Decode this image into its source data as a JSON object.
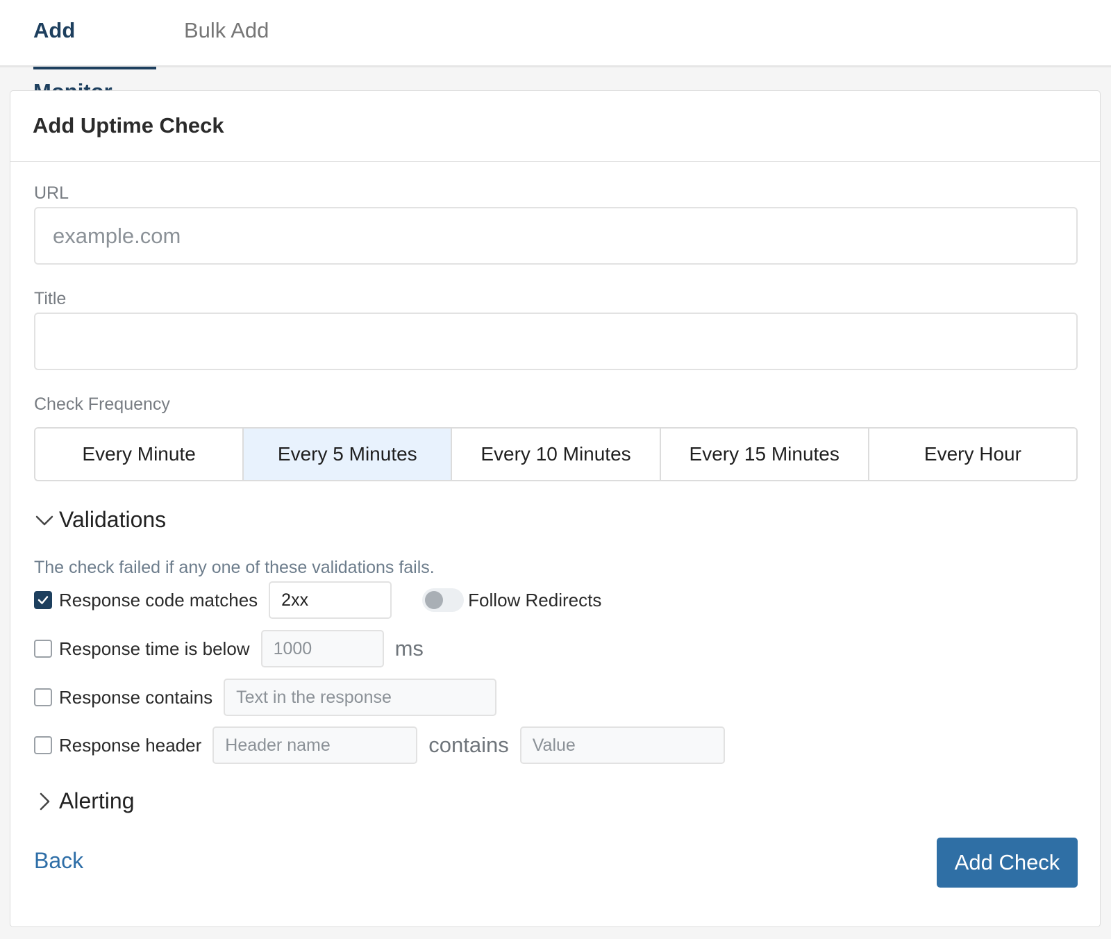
{
  "tabs": [
    {
      "label": "Add Monitor",
      "active": true
    },
    {
      "label": "Bulk Add",
      "active": false
    }
  ],
  "card": {
    "title": "Add Uptime Check"
  },
  "url_field": {
    "label": "URL",
    "placeholder": "example.com",
    "value": ""
  },
  "title_field": {
    "label": "Title",
    "placeholder": "",
    "value": ""
  },
  "frequency": {
    "label": "Check Frequency",
    "options": [
      "Every Minute",
      "Every 5 Minutes",
      "Every 10 Minutes",
      "Every 15 Minutes",
      "Every Hour"
    ],
    "selected": "Every 5 Minutes"
  },
  "validations": {
    "title": "Validations",
    "expanded": true,
    "helper": "The check failed if any one of these validations fails.",
    "response_code": {
      "label": "Response code matches",
      "checked": true,
      "value": "2xx"
    },
    "follow_redirects": {
      "label": "Follow Redirects",
      "enabled": false
    },
    "response_time": {
      "label": "Response time is below",
      "checked": false,
      "placeholder": "1000",
      "unit": "ms"
    },
    "response_contains": {
      "label": "Response contains",
      "checked": false,
      "placeholder": "Text in the response"
    },
    "response_header": {
      "label": "Response header",
      "checked": false,
      "name_placeholder": "Header name",
      "joiner": "contains",
      "value_placeholder": "Value"
    }
  },
  "alerting": {
    "title": "Alerting",
    "expanded": false
  },
  "footer": {
    "back_label": "Back",
    "submit_label": "Add Check"
  },
  "colors": {
    "primary": "#1d3f5e",
    "button": "#2f6fa5",
    "link": "#2e6ea7",
    "selected_segment": "#e8f2fd"
  }
}
